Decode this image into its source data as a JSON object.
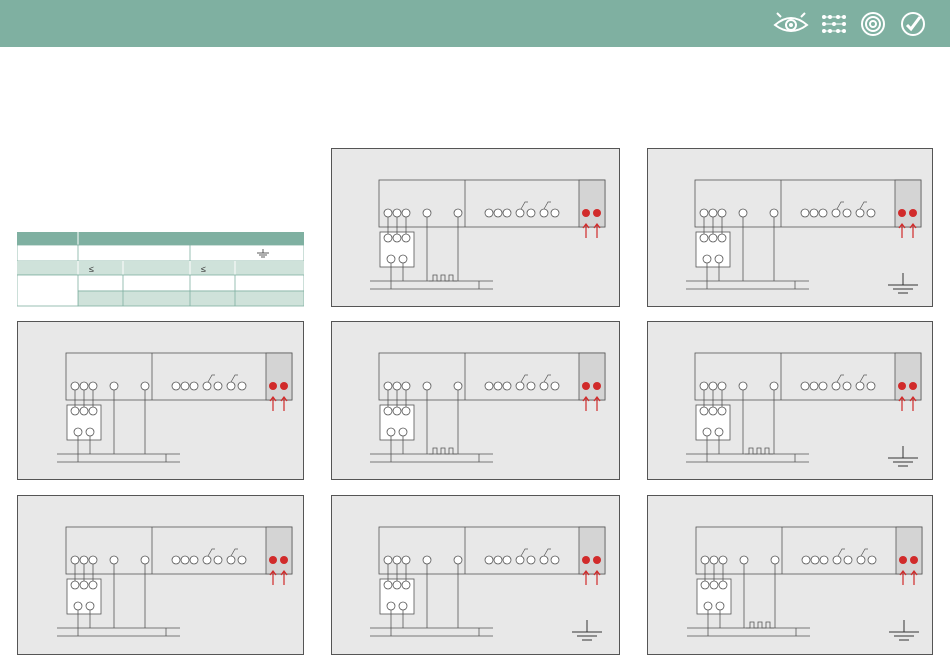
{
  "header": {
    "background": "#7fb0a1",
    "icons": [
      "eye-icon",
      "dots-grid-icon",
      "spiral-icon",
      "check-badge-icon"
    ]
  },
  "colors": {
    "panel_bg": "#e8e8e8",
    "line": "#555555",
    "accent_red": "#d12a2a",
    "table_header": "#7fb0a1",
    "table_row_alt": "#cfe2da"
  },
  "table": {
    "rows": [
      {
        "cells": [
          "",
          ""
        ]
      },
      {
        "cells": [
          "",
          "",
          ""
        ]
      },
      {
        "cells": [
          "",
          "≤",
          "",
          "≤",
          ""
        ]
      },
      {
        "cells": [
          "",
          "",
          "",
          "",
          ""
        ]
      }
    ]
  },
  "diagrams": [
    {
      "id": "panel-1",
      "ground_symbol": false,
      "heater": true
    },
    {
      "id": "panel-2",
      "ground_symbol": true,
      "heater": false
    },
    {
      "id": "panel-3",
      "ground_symbol": false,
      "heater": false
    },
    {
      "id": "panel-4",
      "ground_symbol": false,
      "heater": true
    },
    {
      "id": "panel-5",
      "ground_symbol": true,
      "heater": true
    },
    {
      "id": "panel-6",
      "ground_symbol": false,
      "heater": false
    },
    {
      "id": "panel-7",
      "ground_symbol": true,
      "heater": false
    },
    {
      "id": "panel-8",
      "ground_symbol": true,
      "heater": true
    }
  ]
}
